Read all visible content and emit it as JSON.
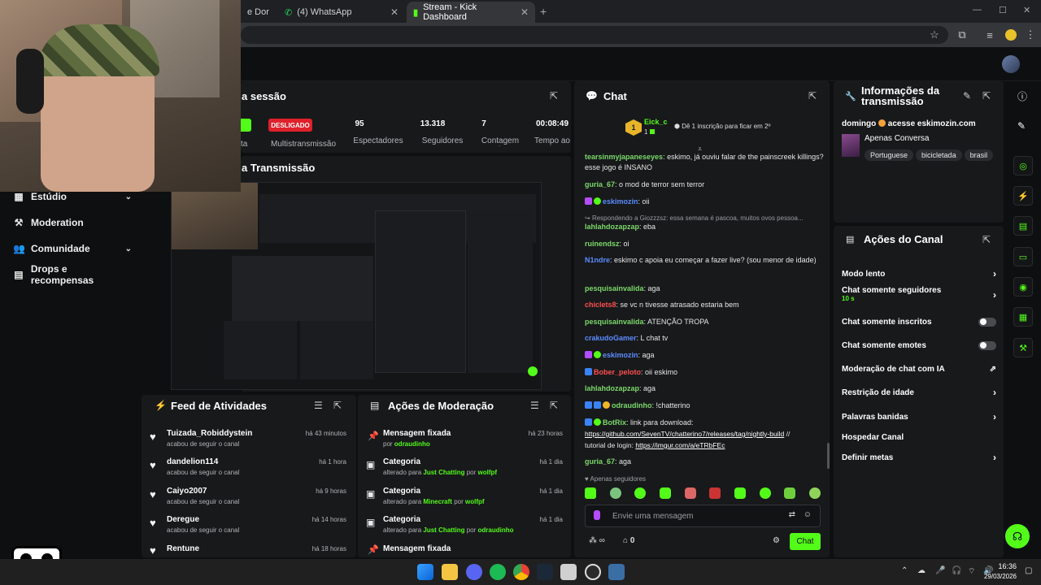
{
  "browser": {
    "tabs": [
      {
        "label": "e Dor"
      },
      {
        "label": "(4) WhatsApp"
      },
      {
        "label": "Stream - Kick Dashboard"
      }
    ]
  },
  "sidebar": {
    "items": [
      {
        "label": "Estúdio",
        "icon": "grid-icon"
      },
      {
        "label": "Moderation",
        "icon": "hammer-icon"
      },
      {
        "label": "Comunidade",
        "icon": "users-icon"
      },
      {
        "label": "Drops e recompensas",
        "icon": "gift-icon"
      }
    ]
  },
  "session": {
    "title": "a sessão",
    "status_on": "",
    "status_off": "DESLIGADO",
    "labels": [
      "ta",
      "Multistransmissão",
      "Espectadores",
      "Seguidores",
      "Contagem de",
      "Tempo ao Vivo"
    ],
    "values": [
      "95",
      "13.318",
      "7",
      "00:08:49"
    ]
  },
  "preview": {
    "title": "a Transmissão"
  },
  "feed": {
    "title": "Feed de Atividades",
    "items": [
      {
        "name": "Tuizada_Robiddystein",
        "sub": "acabou de seguir o canal",
        "time": "há 43 minutos"
      },
      {
        "name": "dandelion114",
        "sub": "acabou de seguir o canal",
        "time": "há 1 hora"
      },
      {
        "name": "Caiyo2007",
        "sub": "acabou de seguir o canal",
        "time": "há 9 horas"
      },
      {
        "name": "Deregue",
        "sub": "acabou de seguir o canal",
        "time": "há 14 horas"
      },
      {
        "name": "Rentune",
        "sub": "",
        "time": "há 18 horas"
      }
    ]
  },
  "moderation": {
    "title": "Ações de Moderação",
    "items": [
      {
        "title": "Mensagem fixada",
        "pre": "por",
        "value": "odraudinho",
        "mid": "",
        "by": "",
        "time": "há 23 horas"
      },
      {
        "title": "Categoria",
        "pre": "alterado para",
        "value": "Just Chatting",
        "mid": "por",
        "by": "wolfpf",
        "time": "há 1 dia"
      },
      {
        "title": "Categoria",
        "pre": "alterado para",
        "value": "Minecraft",
        "mid": "por",
        "by": "wolfpf",
        "time": "há 1 dia"
      },
      {
        "title": "Categoria",
        "pre": "alterado para",
        "value": "Just Chatting",
        "mid": "por",
        "by": "odraudinho",
        "time": "há 1 dia"
      },
      {
        "title": "Mensagem fixada",
        "pre": "",
        "value": "",
        "mid": "",
        "by": "",
        "time": ""
      }
    ]
  },
  "chat": {
    "title": "Chat",
    "top_user": "Eick_c",
    "top_rank": "1",
    "top_count": "1",
    "sub_goal": "Dê 1 inscrição para ficar em 2º",
    "messages": [
      {
        "user": "tearsinmyjapaneseyes",
        "text": ": eskimo, já ouviu falar de the painscreek killings? esse jogo é INSANO"
      },
      {
        "user": "guria_67",
        "text": ": o mod de terror sem terror"
      },
      {
        "user": "eskimozin",
        "text": ": oii"
      },
      {
        "user": "Respondendo a Giozzzsz: essa semana é pascoa, muitos ovos pessoa...",
        "text": ""
      },
      {
        "user": "lahlahdozapzap",
        "text": ": eba"
      },
      {
        "user": "ruinendsz",
        "text": ": oi"
      },
      {
        "user": "N1ndre",
        "text": ": eskimo c apoia eu começar a fazer live? (sou menor de idade)"
      },
      {
        "user": "pesquisainvalida",
        "text": ": aga"
      },
      {
        "user": "chiclets8",
        "text": ": se vc n tivesse atrasado estaria bem"
      },
      {
        "user": "pesquisainvalida",
        "text": ": ATENÇÃO TROPA"
      },
      {
        "user": "crakudoGamer",
        "text": ": L chat tv"
      },
      {
        "user": "eskimozin",
        "text": ": aga"
      },
      {
        "user": "Bober_peloto",
        "text": ": oii eskimo"
      },
      {
        "user": "lahlahdozapzap",
        "text": ": aga"
      },
      {
        "user": "odraudinho",
        "text": ": !chatterino"
      },
      {
        "user": "BotRix",
        "text": ": link para download:"
      },
      {
        "user": "https://github.com/SevenTV/chatterino7/releases/tag/nightly-build",
        "text": " //"
      },
      {
        "user": "tutorial de login: ",
        "text": "https://imgur.com/a/eTRbFEc"
      },
      {
        "user": "guria_67",
        "text": ": aga"
      }
    ],
    "followers_only": "Apenas seguidores",
    "input_placeholder": "Envie uma mensagem",
    "send_label": "Chat",
    "infinity": "∞",
    "count": "0"
  },
  "stream_info": {
    "title_line1": "Informações da",
    "title_line2": "transmissão",
    "stream_title": "domingo",
    "stream_title_rest": "acesse eskimozin.com",
    "category": "Apenas Conversa",
    "tags": [
      "Portuguese",
      "bicicletada",
      "brasil"
    ]
  },
  "channel_actions": {
    "title": "Ações do Canal",
    "items": [
      {
        "label": "Modo lento",
        "control": "chevron"
      },
      {
        "label": "Chat somente seguidores",
        "control": "chevron",
        "sub": "10 s"
      },
      {
        "label": "Chat somente inscritos",
        "control": "toggle"
      },
      {
        "label": "Chat somente emotes",
        "control": "toggle"
      },
      {
        "label": "Moderação de chat com IA",
        "control": "external"
      },
      {
        "label": "Restrição de idade",
        "control": "chevron"
      },
      {
        "label": "Palavras banidas",
        "control": "chevron"
      },
      {
        "label": "Hospedar Canal",
        "control": "none"
      },
      {
        "label": "Definir metas",
        "control": "chevron"
      }
    ]
  },
  "taskbar": {
    "time": "16:36",
    "date": "29/03/2026"
  },
  "colors": {
    "accent": "#53fc18",
    "danger": "#e0202b",
    "panel": "#18191b"
  }
}
